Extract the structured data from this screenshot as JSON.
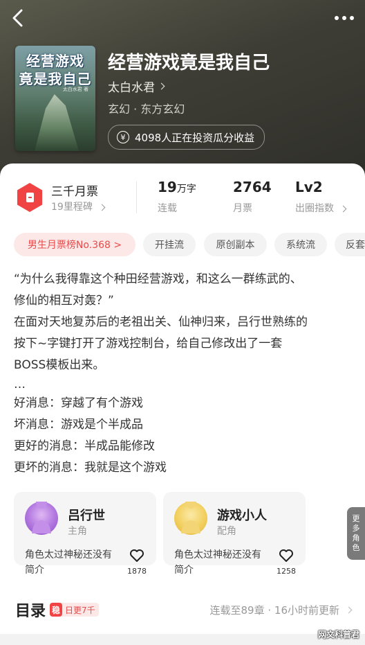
{
  "book": {
    "title": "经营游戏竟是我自己",
    "author": "太白水君",
    "genre": "玄幻 · 东方玄幻",
    "invest_text": "4098人正在投资瓜分收益",
    "cover_title_line1": "经营游戏",
    "cover_title_line2": "竟是我自己",
    "cover_author": "太白水君 著"
  },
  "stats": {
    "ticket_title": "三千月票",
    "ticket_sub": "19里程碑",
    "words_value": "19",
    "words_unit": "万字",
    "words_label": "连载",
    "votes_value": "2764",
    "votes_label": "月票",
    "level_value": "Lv2",
    "level_label": "出圈指数"
  },
  "tags": [
    "男生月票榜No.368 >",
    "开挂流",
    "原创副本",
    "系统流",
    "反套路"
  ],
  "description": [
    "“为什么我得靠这个种田经营游戏，和这么一群练武的、",
    "修仙的相互对轰？”",
    "在面对天地复苏后的老祖出关、仙神归来，吕行世熟练的",
    "按下~字键打开了游戏控制台，给自己修改出了一套",
    "BOSS模板出来。",
    "…",
    "好消息：穿越了有个游戏",
    "坏消息：游戏是个半成品",
    "更好的消息：半成品能修改",
    "更坏的消息：我就是这个游戏"
  ],
  "roles": [
    {
      "name": "吕行世",
      "type": "主角",
      "desc": "角色太过神秘还没有简介",
      "likes": "1878"
    },
    {
      "name": "游戏小人",
      "type": "配角",
      "desc": "角色太过神秘还没有简介",
      "likes": "1258"
    }
  ],
  "more_roles": "更多角色",
  "toc": {
    "title": "目录",
    "badge_icon": "稳",
    "badge_text": "日更7千",
    "info": "连载至89章 · 16小时前更新"
  },
  "watermark": "网文科普君",
  "colors": {
    "accent": "#f04444",
    "tag_hot_bg": "#fde8e8"
  }
}
